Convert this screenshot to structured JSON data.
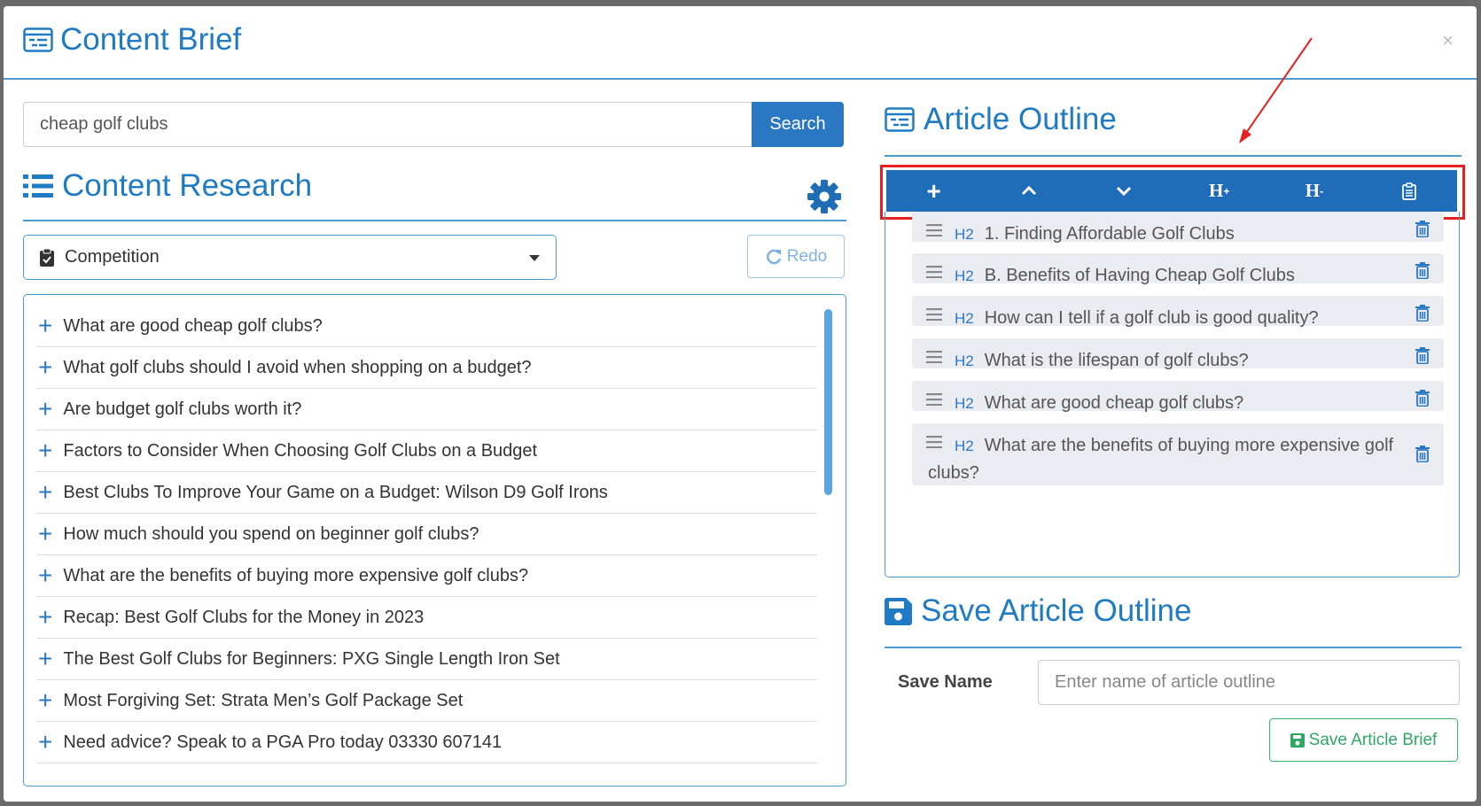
{
  "modal": {
    "title": "Content Brief",
    "close_label": "×"
  },
  "search": {
    "value": "cheap golf clubs",
    "button_label": "Search"
  },
  "content_research": {
    "title": "Content Research",
    "select_value": "Competition",
    "redo_label": "Redo",
    "items": [
      "What are good cheap golf clubs?",
      "What golf clubs should I avoid when shopping on a budget?",
      "Are budget golf clubs worth it?",
      "Factors to Consider When Choosing Golf Clubs on a Budget",
      "Best Clubs To Improve Your Game on a Budget: Wilson D9 Golf Irons",
      "How much should you spend on beginner golf clubs?",
      "What are the benefits of buying more expensive golf clubs?",
      "Recap: Best Golf Clubs for the Money in 2023",
      "The Best Golf Clubs for Beginners: PXG Single Length Iron Set",
      "Most Forgiving Set: Strata Men’s Golf Package Set",
      "Need advice? Speak to a PGA Pro today 03330 607141"
    ]
  },
  "article_outline": {
    "title": "Article Outline",
    "toolbar": {
      "add": "+",
      "heading_up": "H",
      "heading_up_sub": "+",
      "heading_down": "H",
      "heading_down_sub": "-"
    },
    "items": [
      {
        "tag": "H2",
        "text": "1. Finding Affordable Golf Clubs"
      },
      {
        "tag": "H2",
        "text": "B. Benefits of Having Cheap Golf Clubs"
      },
      {
        "tag": "H2",
        "text": "How can I tell if a golf club is good quality?"
      },
      {
        "tag": "H2",
        "text": "What is the lifespan of golf clubs?"
      },
      {
        "tag": "H2",
        "text": "What are good cheap golf clubs?"
      },
      {
        "tag": "H2",
        "text": "What are the benefits of buying more expensive golf clubs?"
      }
    ]
  },
  "save_outline": {
    "title": "Save Article Outline",
    "name_label": "Save Name",
    "name_placeholder": "Enter name of article outline",
    "button_label": "Save Article Brief"
  },
  "colors": {
    "brand_blue": "#1e7bc4",
    "toolbar_blue": "#1f6db8",
    "highlight_red": "#e82020",
    "success_green": "#2fa864"
  }
}
